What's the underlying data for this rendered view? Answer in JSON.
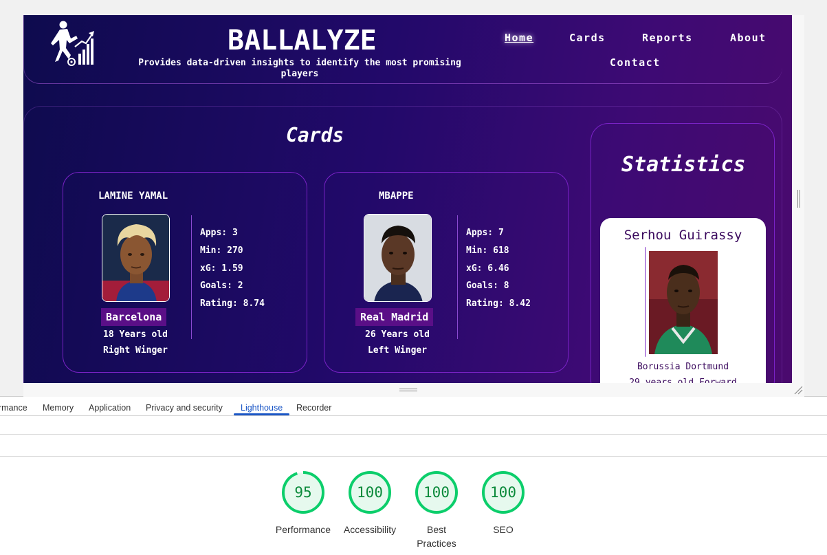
{
  "site": {
    "brand": "BALLALYZE",
    "tagline": "Provides data-driven insights to identify the most promising players",
    "nav": [
      "Home",
      "Cards",
      "Reports",
      "About",
      "Contact"
    ],
    "active_nav": "Home"
  },
  "cards_section": {
    "title": "Cards",
    "cards": [
      {
        "name": "LAMINE YAMAL",
        "club": "Barcelona",
        "age": "18 Years old",
        "position": "Right Winger",
        "stats": [
          "Apps: 3",
          "Min: 270",
          "xG: 1.59",
          "Goals: 2",
          "Rating: 8.74"
        ]
      },
      {
        "name": "MBAPPE",
        "club": "Real Madrid",
        "age": "26 Years old",
        "position": "Left Winger",
        "stats": [
          "Apps: 7",
          "Min: 618",
          "xG: 6.46",
          "Goals: 8",
          "Rating: 8.42"
        ]
      }
    ]
  },
  "statistics": {
    "title": "Statistics",
    "featured": {
      "name": "Serhou Guirassy",
      "club": "Borussia Dortmund",
      "extra": "29 years old Forward"
    }
  },
  "devtools": {
    "tabs": [
      "rmance",
      "Memory",
      "Application",
      "Privacy and security",
      "Lighthouse",
      "Recorder"
    ],
    "active_tab": "Lighthouse"
  },
  "lighthouse": {
    "scores": [
      {
        "value": 95,
        "label": "Performance"
      },
      {
        "value": 100,
        "label": "Accessibility"
      },
      {
        "value": 100,
        "label": "Best Practices"
      },
      {
        "value": 100,
        "label": "SEO"
      }
    ],
    "colors": {
      "good": "#0cce6b",
      "good_fill": "#e6f9ee",
      "good_text": "#0b8a3b"
    }
  },
  "colors": {
    "bg_start": "#0e0b4e",
    "bg_end": "#4a0a6e",
    "card_border": "#7a22c6",
    "club_badge": "#5a0f87",
    "devtools_accent": "#1a56c6"
  }
}
